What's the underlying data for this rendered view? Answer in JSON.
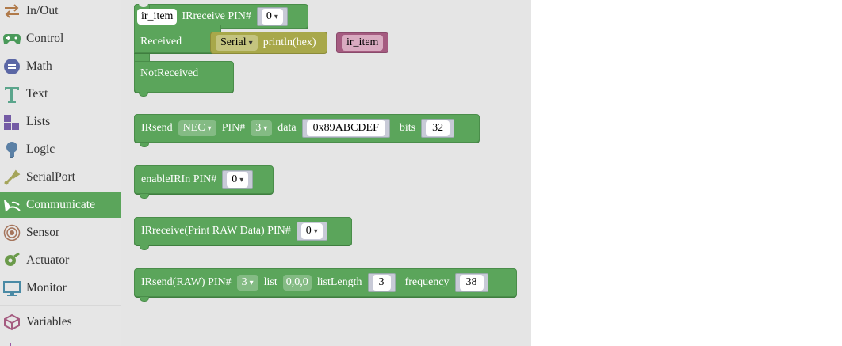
{
  "toolbox": {
    "categories": [
      {
        "label": "In/Out",
        "icon": "in-out-icon",
        "selected": false
      },
      {
        "label": "Control",
        "icon": "gamepad-icon",
        "selected": false
      },
      {
        "label": "Math",
        "icon": "math-icon",
        "selected": false
      },
      {
        "label": "Text",
        "icon": "text-icon",
        "selected": false
      },
      {
        "label": "Lists",
        "icon": "lists-icon",
        "selected": false
      },
      {
        "label": "Logic",
        "icon": "bulb-icon",
        "selected": false
      },
      {
        "label": "SerialPort",
        "icon": "usb-icon",
        "selected": false
      },
      {
        "label": "Communicate",
        "icon": "antenna-icon",
        "selected": true
      },
      {
        "label": "Sensor",
        "icon": "sensor-icon",
        "selected": false
      },
      {
        "label": "Actuator",
        "icon": "actuator-icon",
        "selected": false
      },
      {
        "label": "Monitor",
        "icon": "monitor-icon",
        "selected": false
      },
      {
        "label": "Variables",
        "icon": "variables-icon",
        "selected": false
      }
    ]
  },
  "colors": {
    "communicate": "#5ba55b",
    "serial": "#a8a84a",
    "variable": "#a55b80"
  },
  "blocks": {
    "irreceive": {
      "var_name": "ir_item",
      "label": "IRreceive PIN#",
      "pin": "0",
      "received_label": "Received",
      "notreceived_label": "NotReceived",
      "serial_dropdown": "Serial",
      "println_label": "println(hex)",
      "println_var": "ir_item"
    },
    "irsend": {
      "label": "IRsend",
      "protocol": "NEC",
      "pin_label": "PIN#",
      "pin": "3",
      "data_label": "data",
      "data_value": "0x89ABCDEF",
      "bits_label": "bits",
      "bits_value": "32"
    },
    "enable_irin": {
      "label": "enableIRIn PIN#",
      "pin": "0"
    },
    "irreceive_raw": {
      "label": "IRreceive(Print RAW Data) PIN#",
      "pin": "0"
    },
    "irsend_raw": {
      "label": "IRsend(RAW) PIN#",
      "pin": "3",
      "list_label": "list",
      "list_value": "0,0,0",
      "length_label": "listLength",
      "length_value": "3",
      "freq_label": "frequency",
      "freq_value": "38"
    }
  }
}
